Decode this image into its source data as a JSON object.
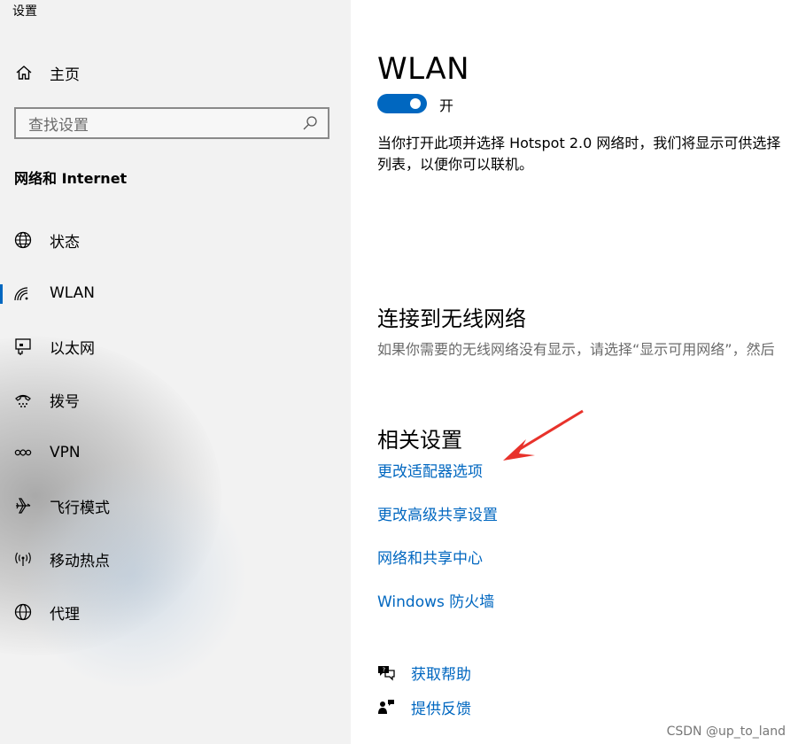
{
  "window": {
    "title": "设置"
  },
  "sidebar": {
    "home_label": "主页",
    "search_placeholder": "查找设置",
    "section_title": "网络和 Internet",
    "items": [
      {
        "label": "状态",
        "icon": "globe-status-icon"
      },
      {
        "label": "WLAN",
        "icon": "wifi-icon",
        "active": true
      },
      {
        "label": "以太网",
        "icon": "ethernet-icon"
      },
      {
        "label": "拨号",
        "icon": "dialup-phone-icon"
      },
      {
        "label": "VPN",
        "icon": "vpn-icon"
      },
      {
        "label": "飞行模式",
        "icon": "airplane-icon"
      },
      {
        "label": "移动热点",
        "icon": "hotspot-icon"
      },
      {
        "label": "代理",
        "icon": "proxy-globe-icon"
      }
    ]
  },
  "main": {
    "title": "WLAN",
    "toggle": {
      "on": true,
      "state_label": "开"
    },
    "desc_line1": "当你打开此项并选择 Hotspot 2.0 网络时，我们将显示可供选择",
    "desc_line2": "列表，以便你可以联机。",
    "connect_heading": "连接到无线网络",
    "connect_desc": "如果你需要的无线网络没有显示，请选择“显示可用网络”，然后",
    "related_heading": "相关设置",
    "related_links": [
      "更改适配器选项",
      "更改高级共享设置",
      "网络和共享中心",
      "Windows 防火墙"
    ],
    "help_label": "获取帮助",
    "feedback_label": "提供反馈"
  },
  "watermark": "CSDN @up_to_land",
  "colors": {
    "accent": "#0067c0",
    "annotation_arrow": "#e8322b",
    "sidebar_bg": "#f2f2f2"
  }
}
